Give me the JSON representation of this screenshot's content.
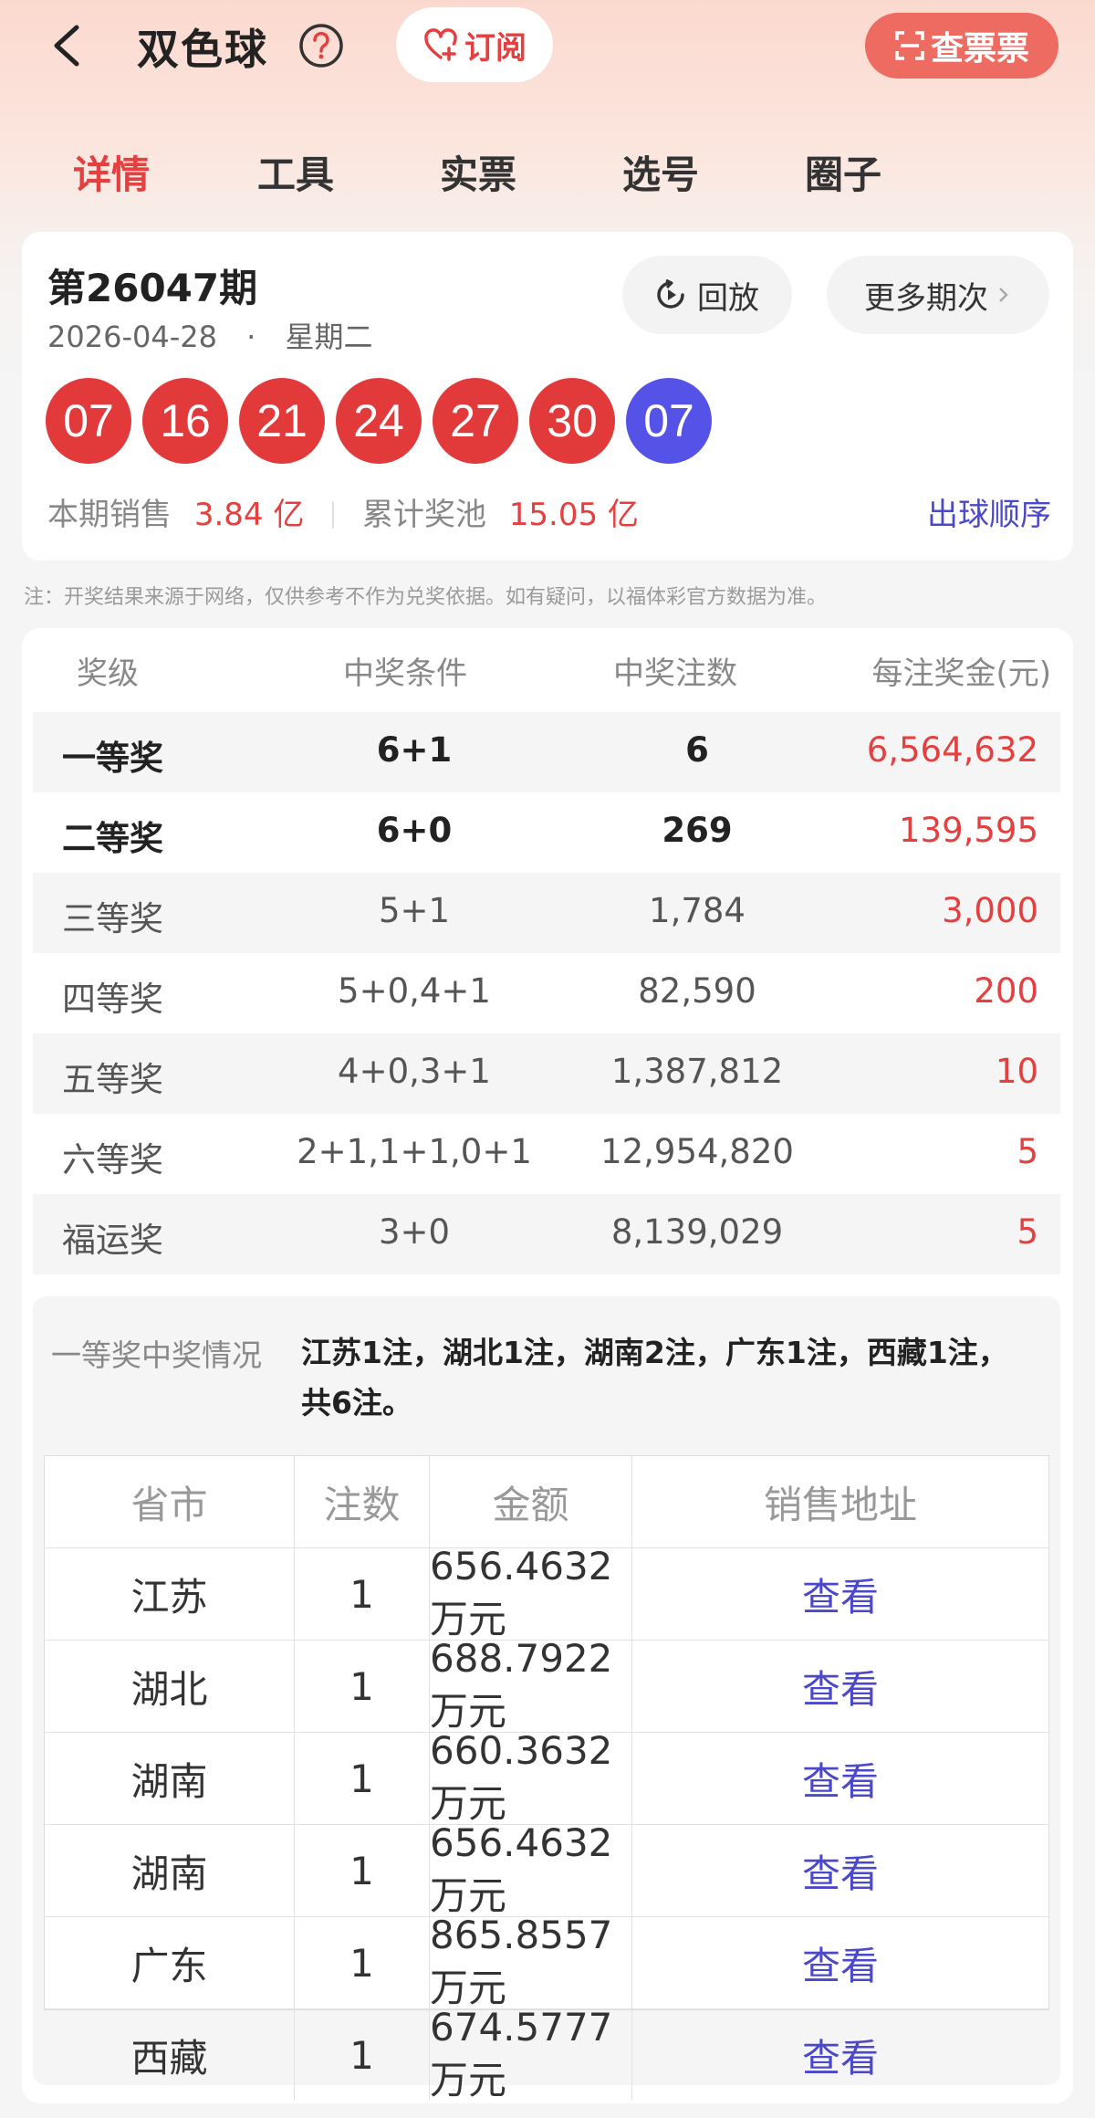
{
  "header": {
    "title": "双色球",
    "subscribe_label": "订阅",
    "check_ticket_label": "查票票"
  },
  "tabs": [
    {
      "label": "详情",
      "active": true
    },
    {
      "label": "工具",
      "active": false
    },
    {
      "label": "实票",
      "active": false
    },
    {
      "label": "选号",
      "active": false
    },
    {
      "label": "圈子",
      "active": false
    }
  ],
  "draw": {
    "issue": "第26047期",
    "date": "2026-04-28",
    "separator": "·",
    "weekday": "星期二",
    "replay_label": "回放",
    "more_label": "更多期次",
    "red_balls": [
      "07",
      "16",
      "21",
      "24",
      "27",
      "30"
    ],
    "blue_balls": [
      "07"
    ],
    "sales_label": "本期销售",
    "sales_value": "3.84 亿",
    "pool_label": "累计奖池",
    "pool_value": "15.05 亿",
    "order_link": "出球顺序"
  },
  "disclaimer": "注：开奖结果来源于网络，仅供参考不作为兑奖依据。如有疑问，以福体彩官方数据为准。",
  "prizes": {
    "headers": [
      "奖级",
      "中奖条件",
      "中奖注数",
      "每注奖金(元)"
    ],
    "rows": [
      {
        "level": "一等奖",
        "condition": "6+1",
        "count": "6",
        "amount": "6,564,632"
      },
      {
        "level": "二等奖",
        "condition": "6+0",
        "count": "269",
        "amount": "139,595"
      },
      {
        "level": "三等奖",
        "condition": "5+1",
        "count": "1,784",
        "amount": "3,000"
      },
      {
        "level": "四等奖",
        "condition": "5+0,4+1",
        "count": "82,590",
        "amount": "200"
      },
      {
        "level": "五等奖",
        "condition": "4+0,3+1",
        "count": "1,387,812",
        "amount": "10"
      },
      {
        "level": "六等奖",
        "condition": "2+1,1+1,0+1",
        "count": "12,954,820",
        "amount": "5"
      },
      {
        "level": "福运奖",
        "condition": "3+0",
        "count": "8,139,029",
        "amount": "5"
      }
    ]
  },
  "first_prize": {
    "label": "一等奖中奖情况",
    "summary": "江苏1注，湖北1注，湖南2注，广东1注，西藏1注，共6注。",
    "headers": [
      "省市",
      "注数",
      "金额",
      "销售地址"
    ],
    "rows": [
      {
        "province": "江苏",
        "count": "1",
        "amount": "656.4632万元",
        "link": "查看"
      },
      {
        "province": "湖北",
        "count": "1",
        "amount": "688.7922万元",
        "link": "查看"
      },
      {
        "province": "湖南",
        "count": "1",
        "amount": "660.3632万元",
        "link": "查看"
      },
      {
        "province": "湖南",
        "count": "1",
        "amount": "656.4632万元",
        "link": "查看"
      },
      {
        "province": "广东",
        "count": "1",
        "amount": "865.8557万元",
        "link": "查看"
      },
      {
        "province": "西藏",
        "count": "1",
        "amount": "674.5777万元",
        "link": "查看"
      }
    ]
  },
  "colors": {
    "accent": "#e3403f",
    "red_ball": "#e23a3a",
    "blue_ball": "#5552e8",
    "link": "#4b48c9"
  }
}
